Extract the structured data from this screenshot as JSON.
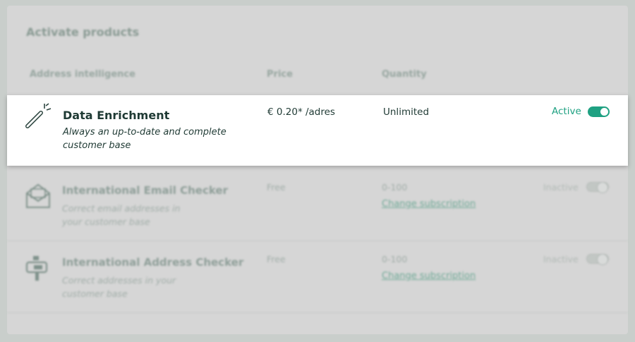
{
  "page": {
    "title": "Activate products"
  },
  "columns": {
    "product": "Address intelligence",
    "price": "Price",
    "quantity": "Quantity"
  },
  "active_product": {
    "name": "Data Enrichment",
    "description": "Always an up-to-date and complete customer base",
    "price": "€ 0.20* /adres",
    "quantity": "Unlimited",
    "status": "Active",
    "toggle_on": true,
    "icon": "magic-wand-icon",
    "accent_color": "#1fa182"
  },
  "products": [
    {
      "name": "International Email Checker",
      "description": "Correct email addresses in your customer base",
      "price": "Free",
      "quantity": "0-100",
      "link": "Change subscription",
      "status": "Inactive",
      "toggle_on": false,
      "icon": "email-icon"
    },
    {
      "name": "International Address Checker",
      "description": "Correct addresses in your customer base",
      "price": "Free",
      "quantity": "0-100",
      "link": "Change subscription",
      "status": "Inactive",
      "toggle_on": false,
      "icon": "mailbox-icon"
    }
  ]
}
